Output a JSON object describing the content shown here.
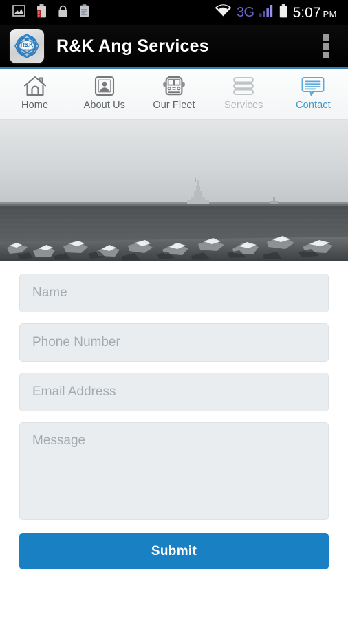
{
  "status_bar": {
    "icons_left": [
      "image-icon",
      "battery-alert-icon",
      "lock-icon",
      "clipboard-icon"
    ],
    "wifi_icon": "wifi-icon",
    "network_label": "3G",
    "signal_icon": "signal-bars-icon",
    "battery_icon": "battery-icon",
    "time": "5:07",
    "meridiem": "PM",
    "colors": {
      "network": "#6b63c8",
      "background": "#000000",
      "text": "#ffffff"
    }
  },
  "app_bar": {
    "logo_icon": "app-logo-icon",
    "logo_text": "R&K",
    "title": "R&K Ang Services",
    "overflow_icon": "overflow-menu-icon",
    "accent_color": "#2f7fb8"
  },
  "tabs": [
    {
      "label": "Home",
      "icon": "home-icon",
      "state": "normal"
    },
    {
      "label": "About Us",
      "icon": "portrait-frame-icon",
      "state": "normal"
    },
    {
      "label": "Our Fleet",
      "icon": "bus-icon",
      "state": "normal"
    },
    {
      "label": "Services",
      "icon": "list-bars-icon",
      "state": "dim"
    },
    {
      "label": "Contact",
      "icon": "speech-bubble-icon",
      "state": "active"
    }
  ],
  "hero": {
    "alt": "black and white photo of a breakwater with lighthouse over water and rocky shore",
    "style": "grayscale-photo"
  },
  "form": {
    "fields": [
      {
        "name": "name",
        "placeholder": "Name",
        "value": "",
        "type": "text"
      },
      {
        "name": "phone",
        "placeholder": "Phone Number",
        "value": "",
        "type": "tel"
      },
      {
        "name": "email",
        "placeholder": "Email Address",
        "value": "",
        "type": "email"
      },
      {
        "name": "message",
        "placeholder": "Message",
        "value": "",
        "type": "textarea"
      }
    ],
    "submit_label": "Submit",
    "submit_color": "#1a80c4"
  }
}
